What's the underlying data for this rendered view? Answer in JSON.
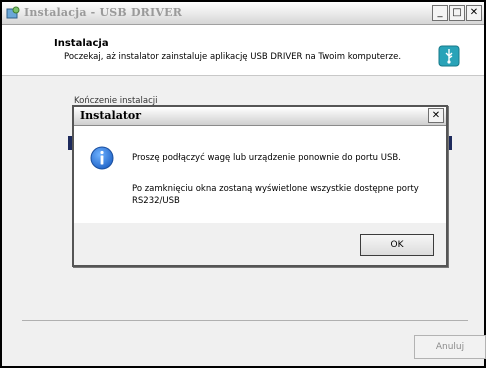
{
  "window": {
    "title": "Instalacja - USB DRIVER",
    "controls": {
      "minimize": "_",
      "maximize": "□",
      "close": "✕"
    }
  },
  "header": {
    "title": "Instalacja",
    "subtitle": "Poczekaj, aż instalator zainstaluje aplikację USB DRIVER na Twoim komputerze."
  },
  "body": {
    "status": "Kończenie instalacji"
  },
  "footer": {
    "cancel_label": "Anuluj"
  },
  "dialog": {
    "title": "Instalator",
    "close": "✕",
    "message1": "Proszę podłączyć wagę lub urządzenie ponownie do portu USB.",
    "message2": "Po zamknięciu okna zostaną wyświetlone wszystkie dostępne porty RS232/USB",
    "ok_label": "OK"
  },
  "colors": {
    "progress": "#1d2a5c",
    "info_icon": "#1f63c7"
  }
}
